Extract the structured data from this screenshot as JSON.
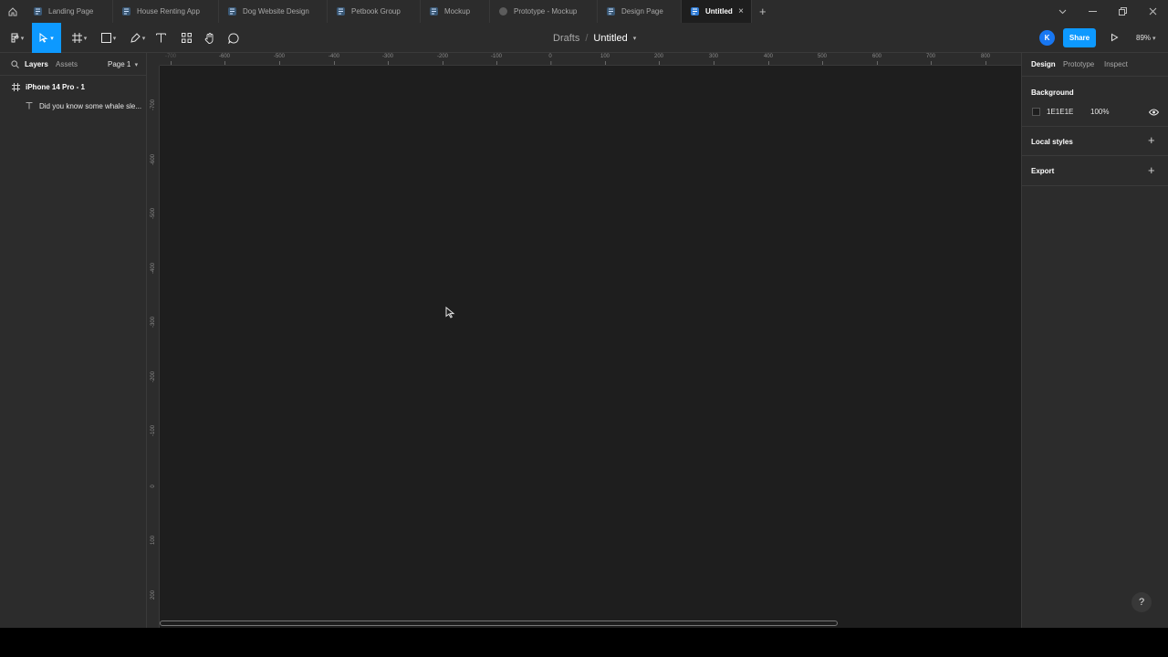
{
  "tabs": [
    {
      "label": "Landing Page",
      "type": "design",
      "active": false
    },
    {
      "label": "House Renting App",
      "type": "design",
      "active": false
    },
    {
      "label": "Dog Website Design",
      "type": "design",
      "active": false
    },
    {
      "label": "Petbook Group",
      "type": "design",
      "active": false
    },
    {
      "label": "Mockup",
      "type": "design",
      "active": false
    },
    {
      "label": "Prototype - Mockup",
      "type": "prototype",
      "active": false
    },
    {
      "label": "Design Page",
      "type": "design",
      "active": false
    },
    {
      "label": "Untitled",
      "type": "design",
      "active": true
    }
  ],
  "tab_close": "×",
  "new_tab": "+",
  "window_controls": {
    "minimize": "—",
    "restore": "❐",
    "close": "✕",
    "dropdown": "⌄"
  },
  "toolbar": {
    "breadcrumb_project": "Drafts",
    "breadcrumb_sep": "/",
    "file_name": "Untitled",
    "avatar_initial": "K",
    "share_label": "Share",
    "zoom_label": "89%",
    "accent": "#0d99ff"
  },
  "left_panel": {
    "tabs": {
      "layers": "Layers",
      "assets": "Assets",
      "page": "Page 1"
    },
    "layers": [
      {
        "name": "iPhone 14 Pro - 1",
        "icon": "frame-icon"
      },
      {
        "name": "Did you know some whale sle...",
        "icon": "text-icon"
      }
    ]
  },
  "rulers": {
    "x": [
      "-700",
      "-600",
      "-500",
      "-400",
      "-300",
      "-200",
      "-100",
      "0",
      "100",
      "200",
      "300",
      "400",
      "500",
      "600",
      "700",
      "800"
    ],
    "y": [
      "-700",
      "-600",
      "-500",
      "-400",
      "-300",
      "-200",
      "-100",
      "0",
      "100",
      "200"
    ]
  },
  "right_panel": {
    "tabs": {
      "design": "Design",
      "prototype": "Prototype",
      "inspect": "Inspect"
    },
    "background_title": "Background",
    "background_hex": "1E1E1E",
    "background_color": "#1E1E1E",
    "background_opacity": "100%",
    "local_styles": "Local styles",
    "export": "Export",
    "plus": "+"
  },
  "help_label": "?"
}
